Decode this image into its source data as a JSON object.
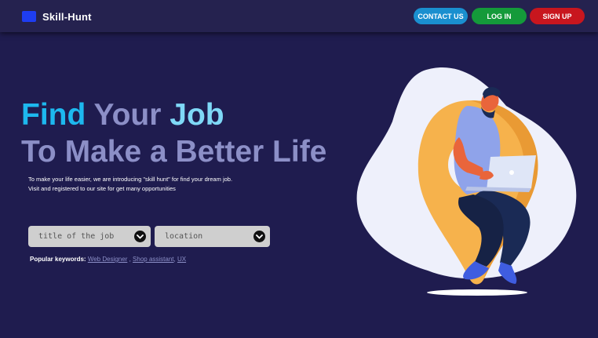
{
  "colors": {
    "background": "#1f1c4f",
    "navbar": "#25224f",
    "accent_blue": "#1db8ef",
    "muted_lavender": "#8c8fc7",
    "contact_button": "#1a8fcf",
    "login_button": "#149a3a",
    "signup_button": "#c8161e"
  },
  "header": {
    "logo_icon": "briefcase-icon",
    "brand": "Skill-Hunt",
    "contact_label": "CONTACT US",
    "login_label": "LOG IN",
    "signup_label": "SIGN UP"
  },
  "hero": {
    "word_find": "Find",
    "word_your": "Your",
    "word_job": "Job",
    "line2": "To Make a Better Life",
    "intro_line1": "To make your life easier, we are introducing \"skill hunt\" for find your dream job.",
    "intro_line2": "Visit and registered to our site for get many opportunities"
  },
  "search": {
    "title_placeholder": "title of the job",
    "location_placeholder": "location",
    "dropdown_icon": "chevron-down-icon"
  },
  "keywords": {
    "label": "Popular keywords:",
    "items": [
      "Web Designer",
      "Shop assistant",
      "UX"
    ]
  },
  "illustration": {
    "icon": "person-on-location-pin-illustration"
  }
}
